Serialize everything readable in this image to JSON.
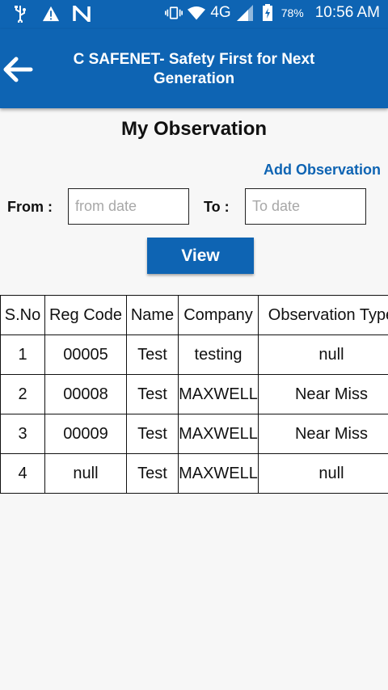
{
  "status_bar": {
    "battery": "78%",
    "time": "10:56 AM",
    "network": "4G"
  },
  "app_bar": {
    "title": "C SAFENET- Safety First for Next Generation"
  },
  "page": {
    "title": "My Observation",
    "add_link": "Add Observation",
    "from_label": "From :",
    "from_placeholder": "from date",
    "to_label": "To :",
    "to_placeholder": "To date",
    "view_label": "View"
  },
  "table": {
    "headers": [
      "S.No",
      "Reg Code",
      "Name",
      "Company",
      "Observation Type"
    ],
    "rows": [
      [
        "1",
        "00005",
        "Test",
        "testing",
        "null"
      ],
      [
        "2",
        "00008",
        "Test",
        "MAXWELL",
        "Near Miss"
      ],
      [
        "3",
        "00009",
        "Test",
        "MAXWELL",
        "Near Miss"
      ],
      [
        "4",
        "null",
        "Test",
        "MAXWELL",
        "null"
      ]
    ]
  },
  "colors": {
    "primary": "#0e64b3",
    "background": "#f7f7f7"
  }
}
